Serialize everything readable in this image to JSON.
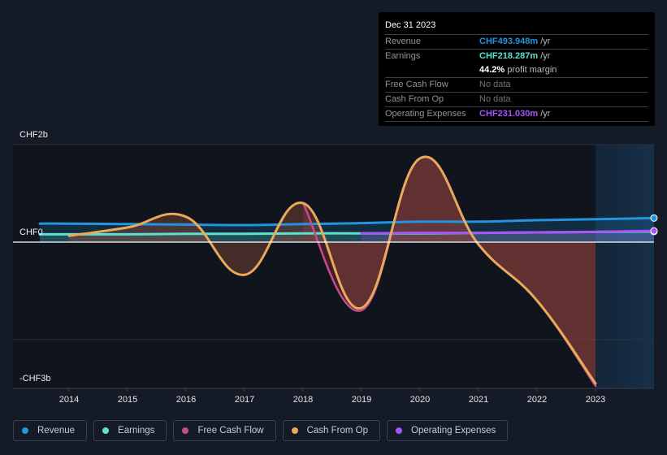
{
  "tooltip": {
    "date": "Dec 31 2023",
    "rows": [
      {
        "label": "Revenue",
        "value": "CHF493.948m",
        "unit": " /yr",
        "color": "#2394df"
      },
      {
        "label": "Earnings",
        "value": "CHF218.287m",
        "unit": " /yr",
        "color": "#5ee0cf"
      },
      {
        "label": "",
        "value": "44.2%",
        "unit": " profit margin",
        "color": "#ffffff"
      },
      {
        "label": "Free Cash Flow",
        "value": "No data",
        "unit": "",
        "color": "#70757d"
      },
      {
        "label": "Cash From Op",
        "value": "No data",
        "unit": "",
        "color": "#70757d"
      },
      {
        "label": "Operating Expenses",
        "value": "CHF231.030m",
        "unit": " /yr",
        "color": "#a855f7"
      }
    ]
  },
  "legend": [
    {
      "label": "Revenue",
      "color": "#2394df"
    },
    {
      "label": "Earnings",
      "color": "#5ee0cf"
    },
    {
      "label": "Free Cash Flow",
      "color": "#c74b8a"
    },
    {
      "label": "Cash From Op",
      "color": "#e8a95b"
    },
    {
      "label": "Operating Expenses",
      "color": "#a855f7"
    }
  ],
  "chart_data": {
    "type": "line",
    "title": "",
    "xlabel": "",
    "ylabel": "",
    "y_unit": "CHF billions",
    "ylim": [
      -3,
      2
    ],
    "xlim": [
      2013.1,
      2024.0
    ],
    "y_tick_labels": [
      {
        "value": 2,
        "label": "CHF2b"
      },
      {
        "value": 0,
        "label": "CHF0"
      },
      {
        "value": -3,
        "label": "-CHF3b"
      }
    ],
    "x_tick_labels": [
      "2014",
      "2015",
      "2016",
      "2017",
      "2018",
      "2019",
      "2020",
      "2021",
      "2022",
      "2023"
    ],
    "x_ticks": [
      2014,
      2015,
      2016,
      2017,
      2018,
      2019,
      2020,
      2021,
      2022,
      2023
    ],
    "forecast_region_start": 2023,
    "grid": true,
    "legend_position": "bottom",
    "series": [
      {
        "name": "Revenue",
        "color": "#2394df",
        "x": [
          2013.5,
          2014,
          2015,
          2016,
          2017,
          2018,
          2019,
          2020,
          2021,
          2022,
          2023,
          2024
        ],
        "values": [
          0.38,
          0.38,
          0.37,
          0.36,
          0.35,
          0.37,
          0.39,
          0.42,
          0.42,
          0.45,
          0.47,
          0.494
        ]
      },
      {
        "name": "Earnings",
        "color": "#5ee0cf",
        "x": [
          2013.5,
          2014,
          2015,
          2016,
          2017,
          2018,
          2019,
          2020,
          2021,
          2022,
          2023,
          2024
        ],
        "values": [
          0.16,
          0.16,
          0.16,
          0.17,
          0.17,
          0.18,
          0.18,
          0.18,
          0.19,
          0.2,
          0.21,
          0.218
        ]
      },
      {
        "name": "Free Cash Flow",
        "color": "#c74b8a",
        "x": [
          2018,
          2019,
          2020,
          2021,
          2022,
          2023
        ],
        "values": [
          0.8,
          -1.4,
          1.72,
          -0.05,
          -1.2,
          -2.95
        ]
      },
      {
        "name": "Cash From Op",
        "color": "#e8a95b",
        "x": [
          2014,
          2015,
          2016,
          2017,
          2018,
          2019,
          2020,
          2021,
          2022,
          2023
        ],
        "values": [
          0.13,
          0.3,
          0.52,
          -0.67,
          0.8,
          -1.35,
          1.72,
          -0.05,
          -1.2,
          -2.9
        ]
      },
      {
        "name": "Operating Expenses",
        "color": "#a855f7",
        "x": [
          2019,
          2020,
          2021,
          2022,
          2023,
          2024
        ],
        "values": [
          0.18,
          0.19,
          0.19,
          0.2,
          0.21,
          0.231
        ]
      }
    ]
  }
}
